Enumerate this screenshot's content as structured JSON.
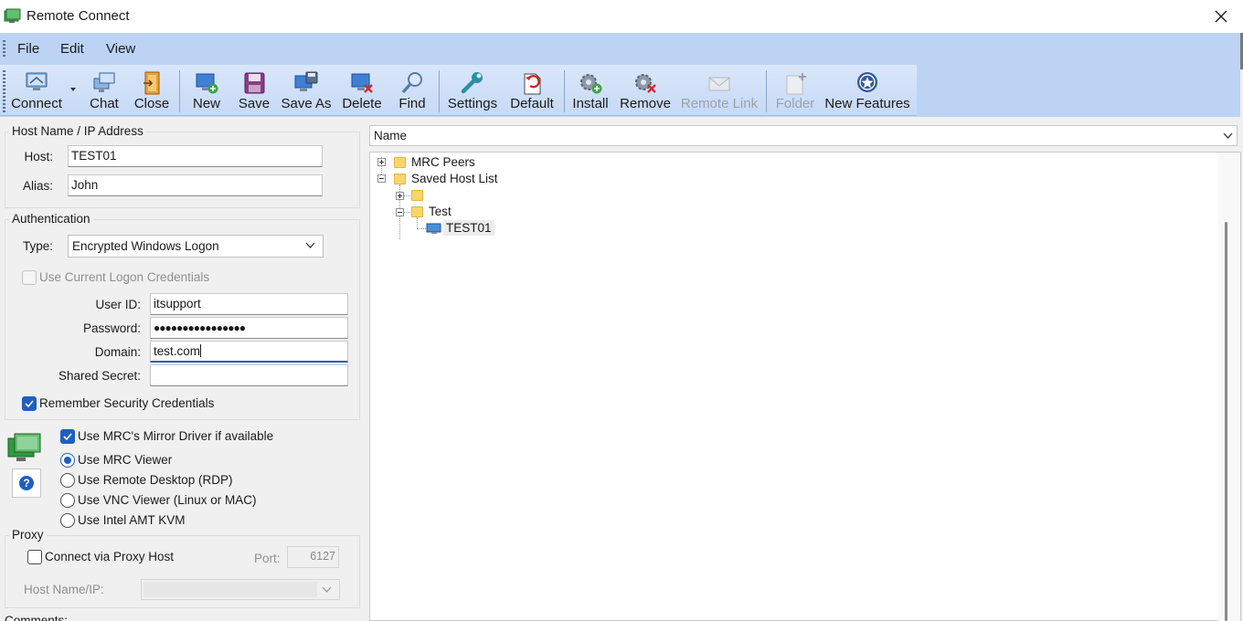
{
  "window": {
    "title": "Remote Connect"
  },
  "menu": [
    "File",
    "Edit",
    "View"
  ],
  "toolbar": [
    {
      "label": "Connect",
      "icon": "monitor-connect-icon",
      "enabled": true
    },
    {
      "label": "Chat",
      "icon": "chat-icon",
      "enabled": true
    },
    {
      "label": "Close",
      "icon": "close-door-icon",
      "enabled": true
    },
    {
      "label": "New",
      "icon": "new-host-icon",
      "enabled": true
    },
    {
      "label": "Save",
      "icon": "save-disk-icon",
      "enabled": true
    },
    {
      "label": "Save As",
      "icon": "save-as-icon",
      "enabled": true
    },
    {
      "label": "Delete",
      "icon": "delete-host-icon",
      "enabled": true
    },
    {
      "label": "Find",
      "icon": "magnifier-icon",
      "enabled": true
    },
    {
      "label": "Settings",
      "icon": "wrench-icon",
      "enabled": true
    },
    {
      "label": "Default",
      "icon": "default-reset-icon",
      "enabled": true
    },
    {
      "label": "Install",
      "icon": "gear-install-icon",
      "enabled": true
    },
    {
      "label": "Remove",
      "icon": "gear-remove-icon",
      "enabled": true
    },
    {
      "label": "Remote Link",
      "icon": "envelope-icon",
      "enabled": false
    },
    {
      "label": "Folder",
      "icon": "new-folder-icon",
      "enabled": false
    },
    {
      "label": "New Features",
      "icon": "star-badge-icon",
      "enabled": true
    }
  ],
  "host_group": {
    "title": "Host Name / IP Address",
    "host_label": "Host:",
    "host_value": "TEST01",
    "alias_label": "Alias:",
    "alias_value": "John"
  },
  "auth_group": {
    "title": "Authentication",
    "type_label": "Type:",
    "type_value": "Encrypted Windows Logon",
    "use_current_label": "Use Current Logon Credentials",
    "userid_label": "User ID:",
    "userid_value": "itsupport",
    "password_label": "Password:",
    "password_value": "●●●●●●●●●●●●●●●●",
    "domain_label": "Domain:",
    "domain_value": "test.com",
    "secret_label": "Shared Secret:",
    "secret_value": "",
    "remember_label": "Remember Security Credentials"
  },
  "viewer_options": {
    "mirror_label": "Use MRC's Mirror Driver if available",
    "help_glyph": "?",
    "radios": [
      {
        "label": "Use MRC Viewer",
        "checked": true
      },
      {
        "label": "Use Remote Desktop (RDP)",
        "checked": false
      },
      {
        "label": "Use VNC Viewer (Linux or MAC)",
        "checked": false
      },
      {
        "label": "Use Intel AMT KVM",
        "checked": false
      }
    ]
  },
  "proxy_group": {
    "title": "Proxy",
    "connect_label": "Connect via Proxy Host",
    "port_label": "Port:",
    "port_value": "6127",
    "host_label": "Host Name/IP:",
    "host_value": ""
  },
  "comments_label": "Comments:",
  "list": {
    "header": "Name",
    "tree": [
      {
        "label": "MRC Peers",
        "kind": "folder",
        "state": "collapsed"
      },
      {
        "label": "Saved Host List",
        "kind": "folder",
        "state": "expanded"
      },
      {
        "label": "",
        "kind": "folder",
        "state": "collapsed"
      },
      {
        "label": "Test",
        "kind": "folder",
        "state": "expanded"
      },
      {
        "label": "TEST01",
        "kind": "computer",
        "state": "leaf"
      }
    ]
  },
  "colors": {
    "accent": "#1f5fbf",
    "toolbar": "#c6d9f5",
    "menubar": "#bcd3f4"
  }
}
